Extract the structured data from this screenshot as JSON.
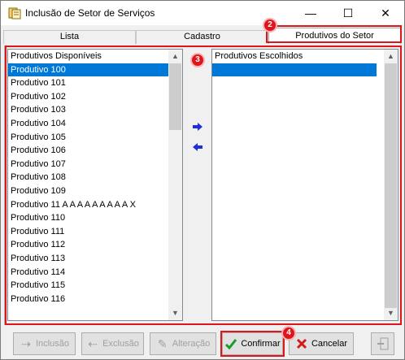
{
  "window": {
    "title": "Inclusão de Setor de Serviços",
    "minimize": "—",
    "maximize": "☐",
    "close": "✕"
  },
  "tabs": [
    {
      "label": "Lista"
    },
    {
      "label": "Cadastro"
    },
    {
      "label": "Produtivos do Setor",
      "active": true
    }
  ],
  "badges": {
    "b2": "2",
    "b3": "3",
    "b4": "4"
  },
  "left_list": {
    "header": "Produtivos Disponíveis",
    "items": [
      "Produtivo 100",
      "Produtivo 101",
      "Produtivo 102",
      "Produtivo 103",
      "Produtivo 104",
      "Produtivo 105",
      "Produtivo 106",
      "Produtivo 107",
      "Produtivo 108",
      "Produtivo 109",
      "Produtivo 11 A A A A A A A A A X",
      "Produtivo 110",
      "Produtivo 111",
      "Produtivo 112",
      "Produtivo 113",
      "Produtivo 114",
      "Produtivo 115",
      "Produtivo 116"
    ],
    "selected_index": 0
  },
  "right_list": {
    "header": "Produtivos Escolhidos",
    "items": [
      ""
    ],
    "selected_index": 0
  },
  "buttons": {
    "inclusao": "Inclusão",
    "exclusao": "Exclusão",
    "alteracao": "Alteração",
    "confirmar": "Confirmar",
    "cancelar": "Cancelar"
  },
  "colors": {
    "accent": "#0078d7",
    "highlight": "#e0141b"
  }
}
